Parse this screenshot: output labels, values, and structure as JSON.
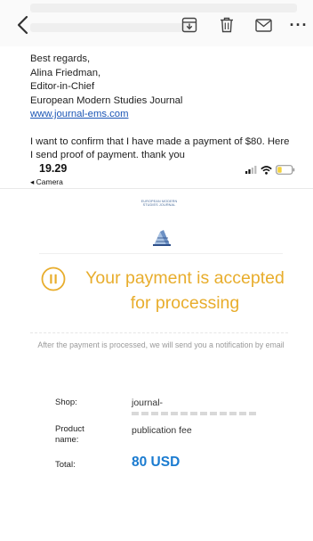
{
  "toolbar": {
    "icons": [
      "back-chevron-icon",
      "archive-icon",
      "trash-icon",
      "mail-icon",
      "more-icon"
    ],
    "more_label": "···"
  },
  "email": {
    "closing": "Best regards,",
    "name": "Alina Friedman,",
    "role": "Editor-in-Chief",
    "org": "European Modern Studies Journal",
    "link": "www.journal-ems.com",
    "message_line1": "I want to confirm that I have made a payment of $80. Here",
    "message_line2": "I send proof of payment. thank you"
  },
  "status_bar": {
    "time": "19.29",
    "back_app": "◂ Camera"
  },
  "payment": {
    "brand_line1": "EUROPEAN MODERN",
    "brand_line2": "STUDIES JOURNAL",
    "title_line1": "Your payment is accepted",
    "title_line2": "for processing",
    "status_icon": "pause-circle-icon",
    "note": "After the payment is processed, we will send you a notification by email",
    "shop_label": "Shop:",
    "shop_value": "journal-",
    "product_label_line1": "Product",
    "product_label_line2": "name:",
    "product_value": "publication fee",
    "total_label": "Total:",
    "total_value": "80 USD"
  },
  "colors": {
    "accent_yellow": "#e8ad2c",
    "total_blue": "#1a7bd0",
    "link_blue": "#1a55b5",
    "battery_yellow": "#f4d23c"
  }
}
